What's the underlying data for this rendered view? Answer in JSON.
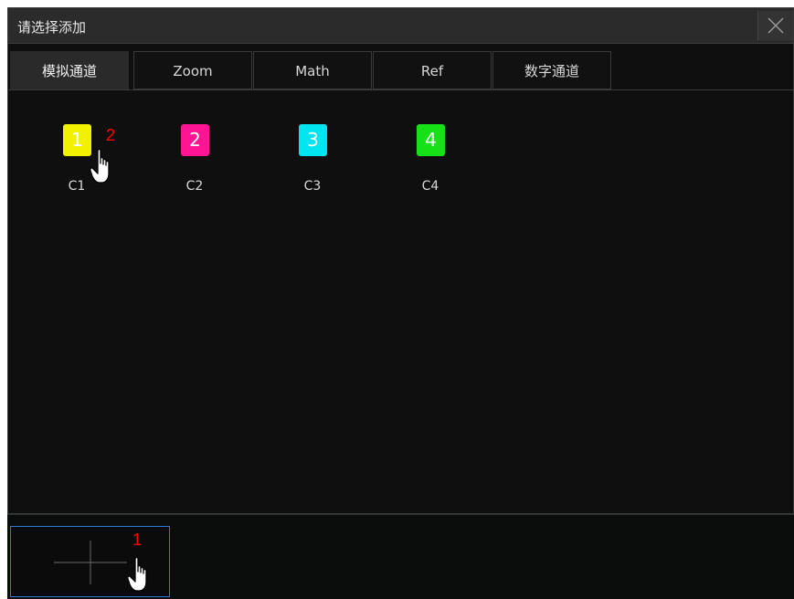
{
  "dialog": {
    "title": "请选择添加"
  },
  "tabs": [
    {
      "label": "模拟通道",
      "active": true
    },
    {
      "label": "Zoom",
      "active": false
    },
    {
      "label": "Math",
      "active": false
    },
    {
      "label": "Ref",
      "active": false
    },
    {
      "label": "数字通道",
      "active": false
    }
  ],
  "channels": [
    {
      "number": "1",
      "label": "C1",
      "color": "#f2f200"
    },
    {
      "number": "2",
      "label": "C2",
      "color": "#ff1493"
    },
    {
      "number": "3",
      "label": "C3",
      "color": "#00e5f0"
    },
    {
      "number": "4",
      "label": "C4",
      "color": "#16e016"
    }
  ],
  "annotations": {
    "step1": "1",
    "step2": "2"
  },
  "icons": {
    "close": "close-icon",
    "add": "add-plus-icon",
    "hand": "hand-pointer-icon"
  },
  "colors": {
    "slot_border": "#2f7ad6",
    "annotation": "#ff0000"
  }
}
